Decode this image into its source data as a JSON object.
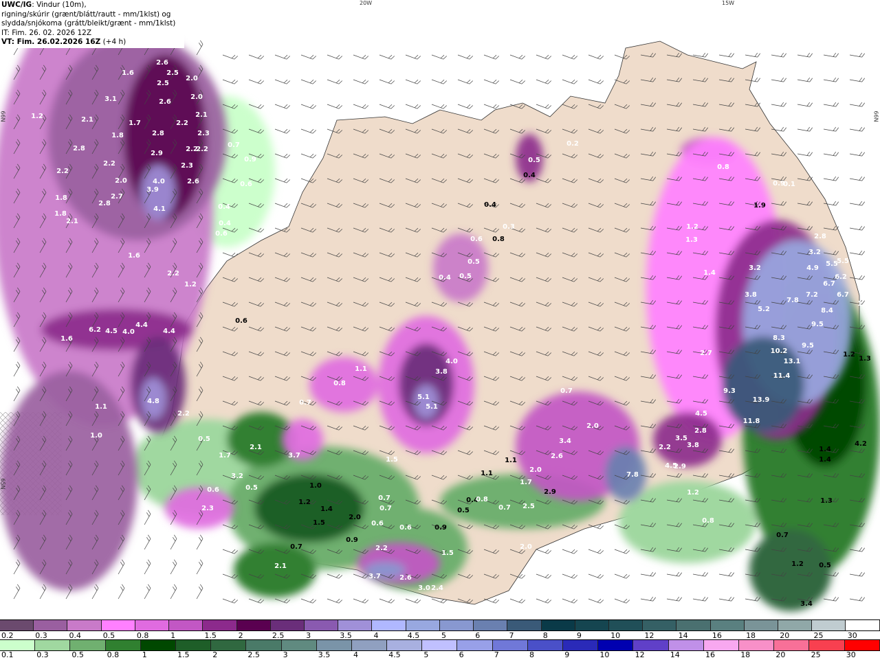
{
  "header": {
    "model": "UWC/IG",
    "line1_rest": ": Vindur (10m),",
    "line2": "rigning/skúrir (grænt/blátt/rautt - mm/1klst) og",
    "line3": "slydda/snjókoma (grátt/bleikt/grænt - mm/1klst)",
    "init_time": "IT: Fim. 26. 02. 2026 12Z",
    "valid_time": "VT: Fim. 26.02.2026 16Z",
    "lead": "(+4 h)"
  },
  "graticule": {
    "lon_20": "20W",
    "lon_15": "15W",
    "lat_66": "66N",
    "lat_65": "65N"
  },
  "map_labels": [
    "2.6",
    "2.5",
    "2.5",
    "2.0",
    "1.6",
    "2.0",
    "3.1",
    "2.6",
    "1.2",
    "2.1",
    "1.7",
    "2.1",
    "2.2",
    "1.8",
    "2.8",
    "2.3",
    "2.8",
    "2.9",
    "2.2",
    "2.2",
    "2.2",
    "2.3",
    "2.2",
    "2.0",
    "4.0",
    "2.6",
    "3.9",
    "1.8",
    "2.7",
    "2.8",
    "4.1",
    "1.8",
    "2.1",
    "0.7",
    "0.9",
    "0.6",
    "0.4",
    "0.4",
    "0.6",
    "1.6",
    "2.2",
    "1.2",
    "1.6",
    "6.2",
    "4.5",
    "4.0",
    "4.4",
    "4.4",
    "0.6",
    "4.8",
    "1.1",
    "2.2",
    "1.0",
    "0.5",
    "1.7",
    "2.1",
    "3.7",
    "3.2",
    "0.5",
    "0.6",
    "2.3",
    "0.4",
    "0.4",
    "0.6",
    "0.5",
    "0.5",
    "0.4",
    "4.0",
    "3.8",
    "5.1",
    "5.1",
    "1.1",
    "0.8",
    "0.7",
    "1.5",
    "1.0",
    "1.2",
    "1.4",
    "2.0",
    "1.5",
    "0.9",
    "0.7",
    "0.7",
    "0.7",
    "0.6",
    "0.6",
    "2.2",
    "1.5",
    "2.1",
    "3.7",
    "2.6",
    "3.0",
    "2.4",
    "0.9",
    "0.5",
    "0.4",
    "0.8",
    "1.1",
    "0.7",
    "1.1",
    "2.0",
    "1.7",
    "2.9",
    "2.6",
    "3.4",
    "0.7",
    "2.0",
    "7.8",
    "2.5",
    "2.0",
    "1.2",
    "0.5",
    "0.4",
    "0.2",
    "0.8",
    "0.4",
    "0.3",
    "0.8",
    "0.9",
    "0.1",
    "1.9",
    "1.2",
    "1.3",
    "1.4",
    "3.2",
    "3.8",
    "5.2",
    "2.8",
    "3.2",
    "4.9",
    "5.5",
    "5.5",
    "6.2",
    "6.7",
    "7.2",
    "6.7",
    "7.8",
    "8.4",
    "9.5",
    "8.3",
    "9.5",
    "10.2",
    "13.1",
    "11.4",
    "9.3",
    "13.9",
    "11.8",
    "2.7",
    "4.5",
    "2.8",
    "3.5",
    "3.8",
    "2.2",
    "4.5",
    "2.9",
    "1.2",
    "0.8",
    "1.6",
    "1.2",
    "1.3",
    "4.2",
    "1.4",
    "1.4",
    "1.3",
    "0.7",
    "1.2",
    "0.5",
    "3.4"
  ],
  "legend": {
    "snow": {
      "labels": [
        "0.2",
        "0.3",
        "0.4",
        "0.5",
        "0.8",
        "1",
        "1.5",
        "2",
        "2.5",
        "3",
        "3.5",
        "4",
        "4.5",
        "5",
        "6",
        "7",
        "8",
        "9",
        "10",
        "12",
        "14",
        "16",
        "18",
        "20",
        "25",
        "30"
      ],
      "colors": [
        "#6b4a6e",
        "#9a5fa0",
        "#c97ac9",
        "#ff80ff",
        "#e06be0",
        "#c257c4",
        "#8c2a8c",
        "#5a0050",
        "#6a2e7a",
        "#8a5ab0",
        "#a090d8",
        "#b0b8ff",
        "#98a8e0",
        "#8898d0",
        "#6a80b0",
        "#3a5a78",
        "#0a3a48",
        "#154550",
        "#204f58",
        "#356065",
        "#4a7070",
        "#5a8080",
        "#7a9498",
        "#90a8a8",
        "#c0ccd0",
        "#ffffff"
      ]
    },
    "rain": {
      "labels": [
        "0.1",
        "0.3",
        "0.5",
        "0.8",
        "1",
        "1.5",
        "2",
        "2.5",
        "3",
        "3.5",
        "4",
        "4.5",
        "5",
        "6",
        "7",
        "8",
        "9",
        "10",
        "12",
        "14",
        "16",
        "18",
        "20",
        "25",
        "30"
      ],
      "colors": [
        "#ccffcc",
        "#a0d8a0",
        "#70b070",
        "#308030",
        "#004800",
        "#1e5e28",
        "#306840",
        "#4a7a68",
        "#608a80",
        "#7a94a8",
        "#90a0c0",
        "#a8b0e0",
        "#c0c0ff",
        "#98a0e8",
        "#7078d8",
        "#4a50c8",
        "#2a2ab8",
        "#0000b0",
        "#6040c8",
        "#c090e8",
        "#f8a8f0",
        "#f890c8",
        "#f87098",
        "#f84050",
        "#ff0000"
      ]
    }
  },
  "colors": {
    "land": "#efdccb",
    "sea": "#ffffff",
    "roads": "#e8703a",
    "coast": "#333333"
  }
}
